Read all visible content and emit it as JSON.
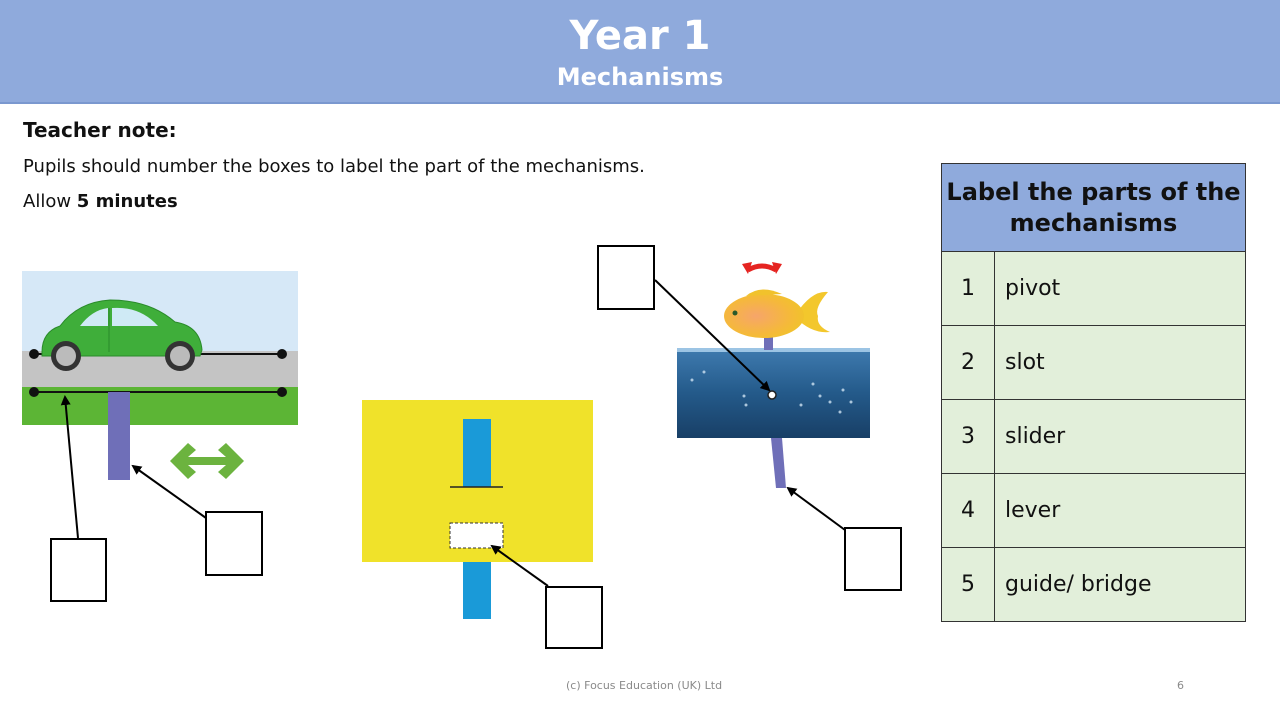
{
  "header": {
    "title": "Year 1",
    "subtitle": "Mechanisms"
  },
  "teacher_note": {
    "title": "Teacher note:",
    "instruction": "Pupils should number the boxes to label the part of the mechanisms.",
    "time_prefix": "Allow",
    "time_value": "5 minutes"
  },
  "label_table": {
    "heading": "Label the parts of the mechanisms",
    "rows": [
      {
        "number": "1",
        "part": "pivot"
      },
      {
        "number": "2",
        "part": "slot"
      },
      {
        "number": "3",
        "part": "slider"
      },
      {
        "number": "4",
        "part": "lever"
      },
      {
        "number": "5",
        "part": "guide/ bridge"
      }
    ]
  },
  "diagrams": [
    {
      "name": "car-slider",
      "description": "Car on road with slider and guide/bridge",
      "motion": "left-right arrow",
      "answer_boxes": 2
    },
    {
      "name": "slot-mechanism",
      "description": "Yellow card with slot and blue slider strip",
      "answer_boxes": 1
    },
    {
      "name": "fish-lever",
      "description": "Fish on a lever with pivot over water scene",
      "motion": "rotating arrow",
      "answer_boxes": 2
    }
  ],
  "colors": {
    "header_bg": "#8faadc",
    "table_body_bg": "#e2efda",
    "slider_purple": "#6f6fb8",
    "card_yellow": "#f0e22a",
    "strip_blue": "#1a9ad8",
    "arrow_green": "#6cb33f",
    "arrow_red": "#e52421"
  },
  "footer": {
    "copyright": "(c) Focus Education (UK) Ltd",
    "page_number": "6"
  }
}
